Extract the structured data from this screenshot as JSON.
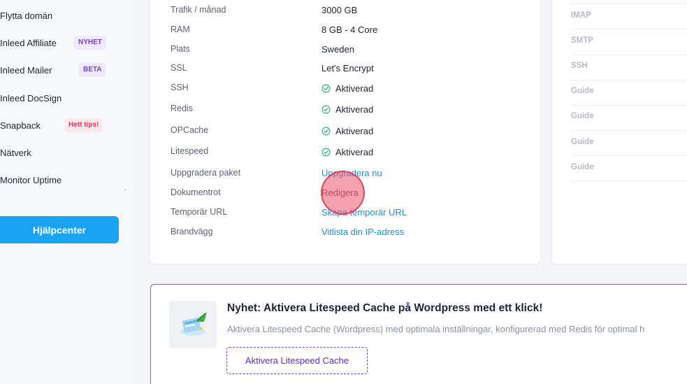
{
  "sidebar": {
    "items": [
      {
        "label": "Flytta domän",
        "badge": ""
      },
      {
        "label": "Inleed Affiliate",
        "badge": "NYHET"
      },
      {
        "label": "Inleed Mailer",
        "badge": "BETA"
      },
      {
        "label": "Inleed DocSign",
        "badge": ""
      },
      {
        "label": "Snapback",
        "badge": "Hett tips!"
      },
      {
        "label": "Nätverk",
        "badge": ""
      },
      {
        "label": "Monitor Uptime",
        "badge": ""
      }
    ],
    "help_button": "Hjälpcenter"
  },
  "details": {
    "rows": [
      {
        "label": "Trafik / månad",
        "value": "3000 GB"
      },
      {
        "label": "RAM",
        "value": "8 GB - 4 Core"
      },
      {
        "label": "Plats",
        "value": "Sweden"
      },
      {
        "label": "SSL",
        "value": "Let's Encrypt"
      },
      {
        "label": "SSH",
        "value": "Aktiverad"
      },
      {
        "label": "Redis",
        "value": "Aktiverad"
      },
      {
        "label": "OPCache",
        "value": "Aktiverad"
      },
      {
        "label": "Litespeed",
        "value": "Aktiverad"
      },
      {
        "label": "Uppgradera paket",
        "value": "Uppgradera nu"
      },
      {
        "label": "Dokumentrot",
        "value": "Redigera"
      },
      {
        "label": "Temporär URL",
        "value": "Skapa temporär URL"
      },
      {
        "label": "Brandvägg",
        "value": "Vitlista din IP-adress"
      }
    ]
  },
  "right_panel": {
    "items": [
      "IMAP",
      "SMTP",
      "SSH",
      "Guide",
      "Guide",
      "Guide",
      "Guide"
    ]
  },
  "promo": {
    "title": "Nyhet: Aktivera Litespeed Cache på Wordpress med ett klick!",
    "description": "Aktivera Litespeed Cache (Wordpress) med optimala inställningar, konfigurerad med Redis för optimal h",
    "button": "Aktivera Litespeed Cache"
  },
  "colors": {
    "accent": "#1aa3f2",
    "link": "#1a8fd6",
    "check": "#2eb872",
    "badge_purple": "#7a3fd0",
    "badge_red": "#e8335a",
    "promo_border": "#8a5cd6"
  }
}
